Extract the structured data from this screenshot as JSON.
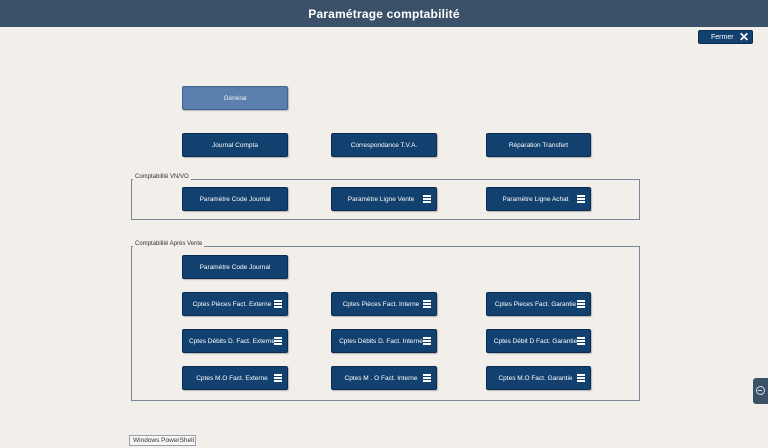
{
  "window": {
    "title": "Paramétrage comptabilité"
  },
  "close_button": {
    "label": "Fermer",
    "icon": "close-icon"
  },
  "top_buttons": {
    "general": "Général",
    "journal_compta": "Journal Compta",
    "correspondance_tva": "Correspondance T.V.A.",
    "reparation_transfert": "Réparation Transfert"
  },
  "vnvo": {
    "legend": "Comptabilité VN/VO",
    "code_journal": "Paramètre Code Journal",
    "ligne_vente": "Paramètre Ligne Vente",
    "ligne_achat": "Paramètre Ligne Achat"
  },
  "apv": {
    "legend": "Comptabilité Après Vente",
    "code_journal": "Paramètre Code Journal",
    "pieces_externe": "Cptes Pièces Fact. Externe",
    "pieces_interne": "Cptes Pièces Fact. Interne",
    "pieces_garantie": "Cptes Pieces Fact. Garantie",
    "debits_externe": "Cptes Débits D. Fact. Externe",
    "debits_interne": "Cptes Débits D. Fact. Interne",
    "debit_garantie": "Cptes Débit D Fact. Garantie",
    "mo_externe": "Cptes M.O Fact. Externe",
    "mo_interne": "Cptes M . O Fact. Interne",
    "mo_garantie": "Cptes M.O Fact. Garantie"
  },
  "taskbar": {
    "powershell": "Windows PowerShell"
  },
  "colors": {
    "titlebar": "#3b5169",
    "button": "#12406f",
    "button_light": "#5a7fae",
    "background": "#f2efea"
  }
}
